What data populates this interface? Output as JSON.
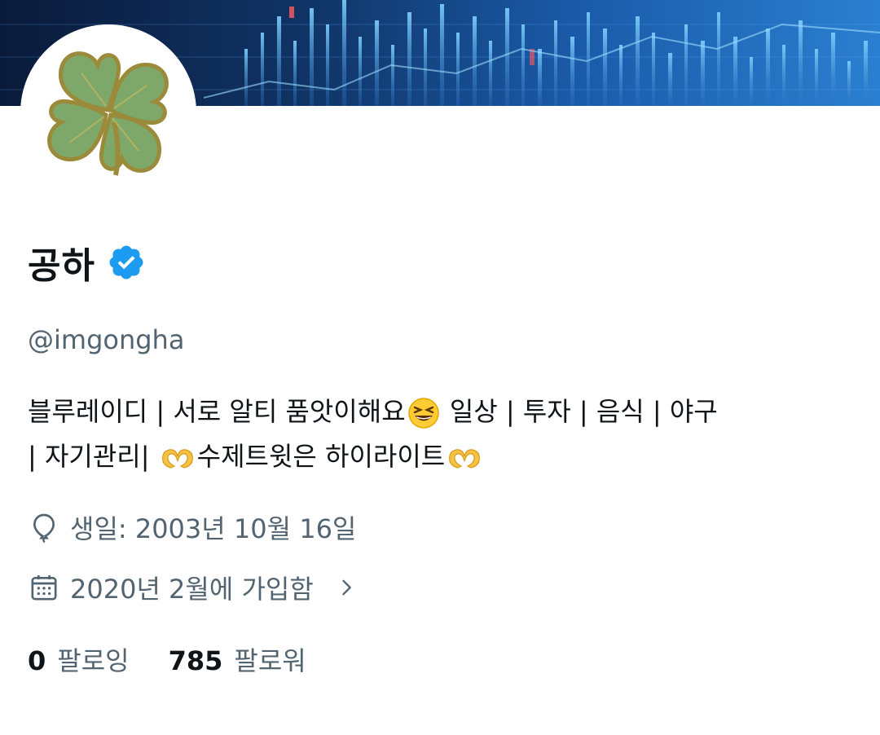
{
  "profile": {
    "display_name": "공하",
    "handle": "@imgongha",
    "bio_line1_a": "블루레이디 | 서로 알티 품앗이해요",
    "bio_line1_b": " 일상 | 투자 | 음식 | 야구",
    "bio_line2_a": "| 자기관리| ",
    "bio_line2_b": "수제트윗은 하이라이트",
    "birthday": "생일: 2003년 10월 16일",
    "joined": "2020년 2월에 가입함",
    "following_count": "0",
    "following_label": "팔로잉",
    "followers_count": "785",
    "followers_label": "팔로워"
  },
  "icons": {
    "verified": "verified-badge-icon",
    "birthday": "balloon-icon",
    "joined": "calendar-icon",
    "chevron": "chevron-right-icon",
    "emoji_laugh": "grinning-squinting-face-icon",
    "emoji_heart_hands": "heart-hands-icon"
  },
  "colors": {
    "verified": "#1d9bf0",
    "secondary_text": "#536471",
    "primary_text": "#0f1419"
  }
}
